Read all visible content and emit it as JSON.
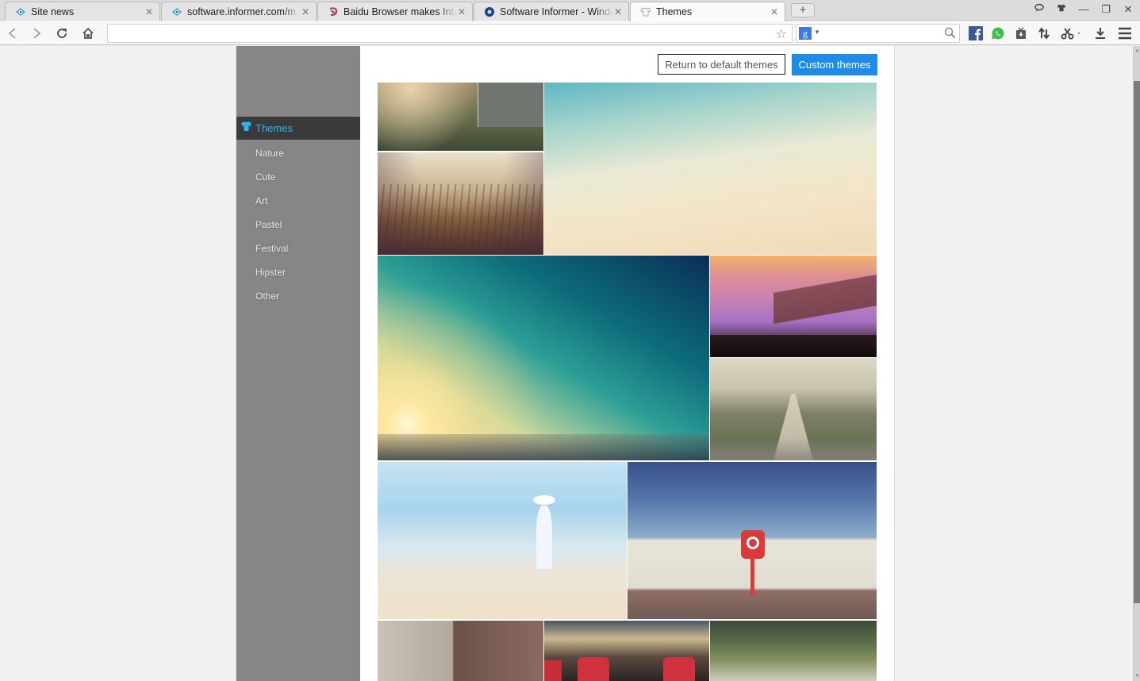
{
  "browser": {
    "tabs": [
      {
        "title": "Site news",
        "favicon": "informer-eye-icon",
        "active": false
      },
      {
        "title": "software.informer.com/m",
        "favicon": "informer-eye-icon",
        "active": false
      },
      {
        "title": "Baidu Browser makes Inter",
        "favicon": "baidu-browser-icon",
        "active": false
      },
      {
        "title": "Software Informer - Windo",
        "favicon": "software-informer-icon",
        "active": false
      },
      {
        "title": "Themes",
        "favicon": "tshirt-icon",
        "active": true
      }
    ],
    "new_tab_label": "+",
    "window_controls": {
      "feedback": "feedback-icon",
      "skin": "tshirt-icon",
      "minimize": "—",
      "restore": "❐",
      "close": "✕"
    },
    "address_bar": {
      "value": "",
      "placeholder": ""
    },
    "search_box": {
      "engine": "g",
      "value": "",
      "placeholder": ""
    },
    "toolbar_icons": [
      "facebook-icon",
      "whatsapp-icon",
      "tv-download-icon",
      "sync-arrows-icon",
      "scissors-icon",
      "download-icon",
      "menu-icon"
    ]
  },
  "sidebar": {
    "header": {
      "label": "Themes",
      "icon": "tshirt-icon",
      "color": "#2ab7ef"
    },
    "items": [
      {
        "label": "Nature"
      },
      {
        "label": "Cute"
      },
      {
        "label": "Art"
      },
      {
        "label": "Pastel"
      },
      {
        "label": "Festival"
      },
      {
        "label": "Hipster"
      },
      {
        "label": "Other"
      }
    ]
  },
  "main": {
    "return_default_label": "Return to default themes",
    "custom_themes_label": "Custom themes",
    "accent_color": "#1e8be8",
    "themes": [
      {
        "name": "misty-meadow"
      },
      {
        "name": "wheat-field"
      },
      {
        "name": "beach-shore"
      },
      {
        "name": "teal-sunset-sky"
      },
      {
        "name": "purple-mountain-clouds"
      },
      {
        "name": "city-street-hill"
      },
      {
        "name": "girl-on-beach"
      },
      {
        "name": "lifebuoy-wall"
      },
      {
        "name": "old-building-bicycle"
      },
      {
        "name": "bar-red-chairs"
      },
      {
        "name": "inverted-forest"
      }
    ]
  }
}
